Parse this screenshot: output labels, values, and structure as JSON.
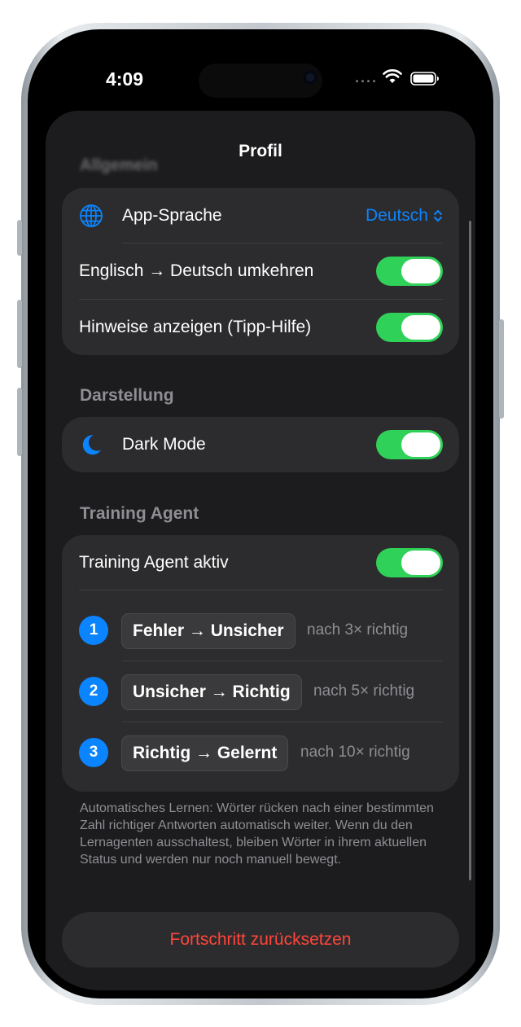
{
  "status_bar": {
    "time": "4:09",
    "signal": "····"
  },
  "sheet": {
    "title": "Profil"
  },
  "sections": {
    "allgemein": {
      "header": "Allgemein",
      "app_language": {
        "label": "App-Sprache",
        "value": "Deutsch"
      },
      "reverse": {
        "label": "Englisch → Deutsch umkehren",
        "enabled": true
      },
      "hints": {
        "label": "Hinweise anzeigen (Tipp-Hilfe)",
        "enabled": true
      }
    },
    "darstellung": {
      "header": "Darstellung",
      "dark_mode": {
        "label": "Dark Mode",
        "enabled": true
      }
    },
    "training": {
      "header": "Training Agent",
      "active": {
        "label": "Training Agent aktiv",
        "enabled": true
      },
      "steps": [
        {
          "number": "1",
          "transition": "Fehler → Unsicher",
          "condition": "nach 3× richtig"
        },
        {
          "number": "2",
          "transition": "Unsicher → Richtig",
          "condition": "nach 5× richtig"
        },
        {
          "number": "3",
          "transition": "Richtig → Gelernt",
          "condition": "nach 10× richtig"
        }
      ],
      "footnote": "Automatisches Lernen: Wörter rücken nach einer bestimmten Zahl richtiger Antworten automatisch weiter. Wenn du den Lernagenten ausschaltest, bleiben Wörter in ihrem aktuellen Status und werden nur noch manuell bewegt."
    }
  },
  "reset_button": {
    "label": "Fortschritt zurücksetzen"
  },
  "colors": {
    "accent": "#0a84ff",
    "toggle_on": "#30d158",
    "destructive": "#ff453a",
    "cell_bg": "#2c2c2e",
    "sheet_bg": "#1c1c1e"
  },
  "icons": {
    "language": "globe-icon",
    "appearance": "moon-icon"
  }
}
